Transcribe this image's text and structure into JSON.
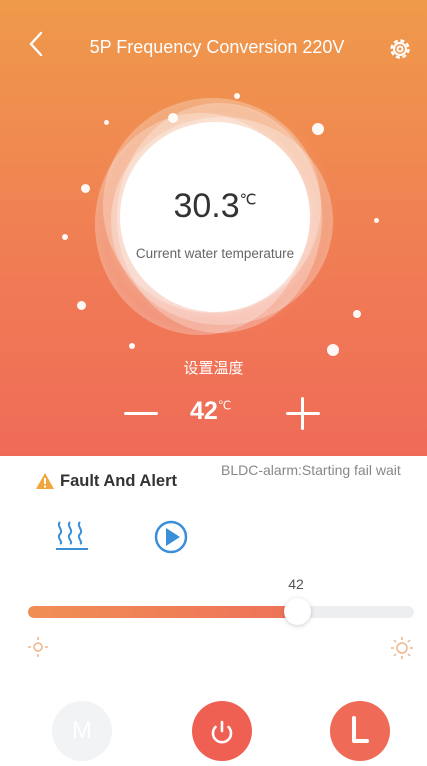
{
  "header": {
    "title": "5P Frequency Conversion 220V"
  },
  "current": {
    "value": "30.3",
    "unit": "℃",
    "label": "Current water temperature"
  },
  "setpoint": {
    "label": "设置温度",
    "value": "42",
    "unit": "℃"
  },
  "fault": {
    "title": "Fault And Alert",
    "message": "BLDC-alarm:Starting fail wait"
  },
  "slider": {
    "value": "42",
    "fraction": 0.7
  },
  "buttons": {
    "mode": "M"
  },
  "colors": {
    "hero_top": "#ef9a4b",
    "hero_bottom": "#ef6b58",
    "accent": "#ef6b58",
    "icon_blue": "#3a8fd8"
  }
}
